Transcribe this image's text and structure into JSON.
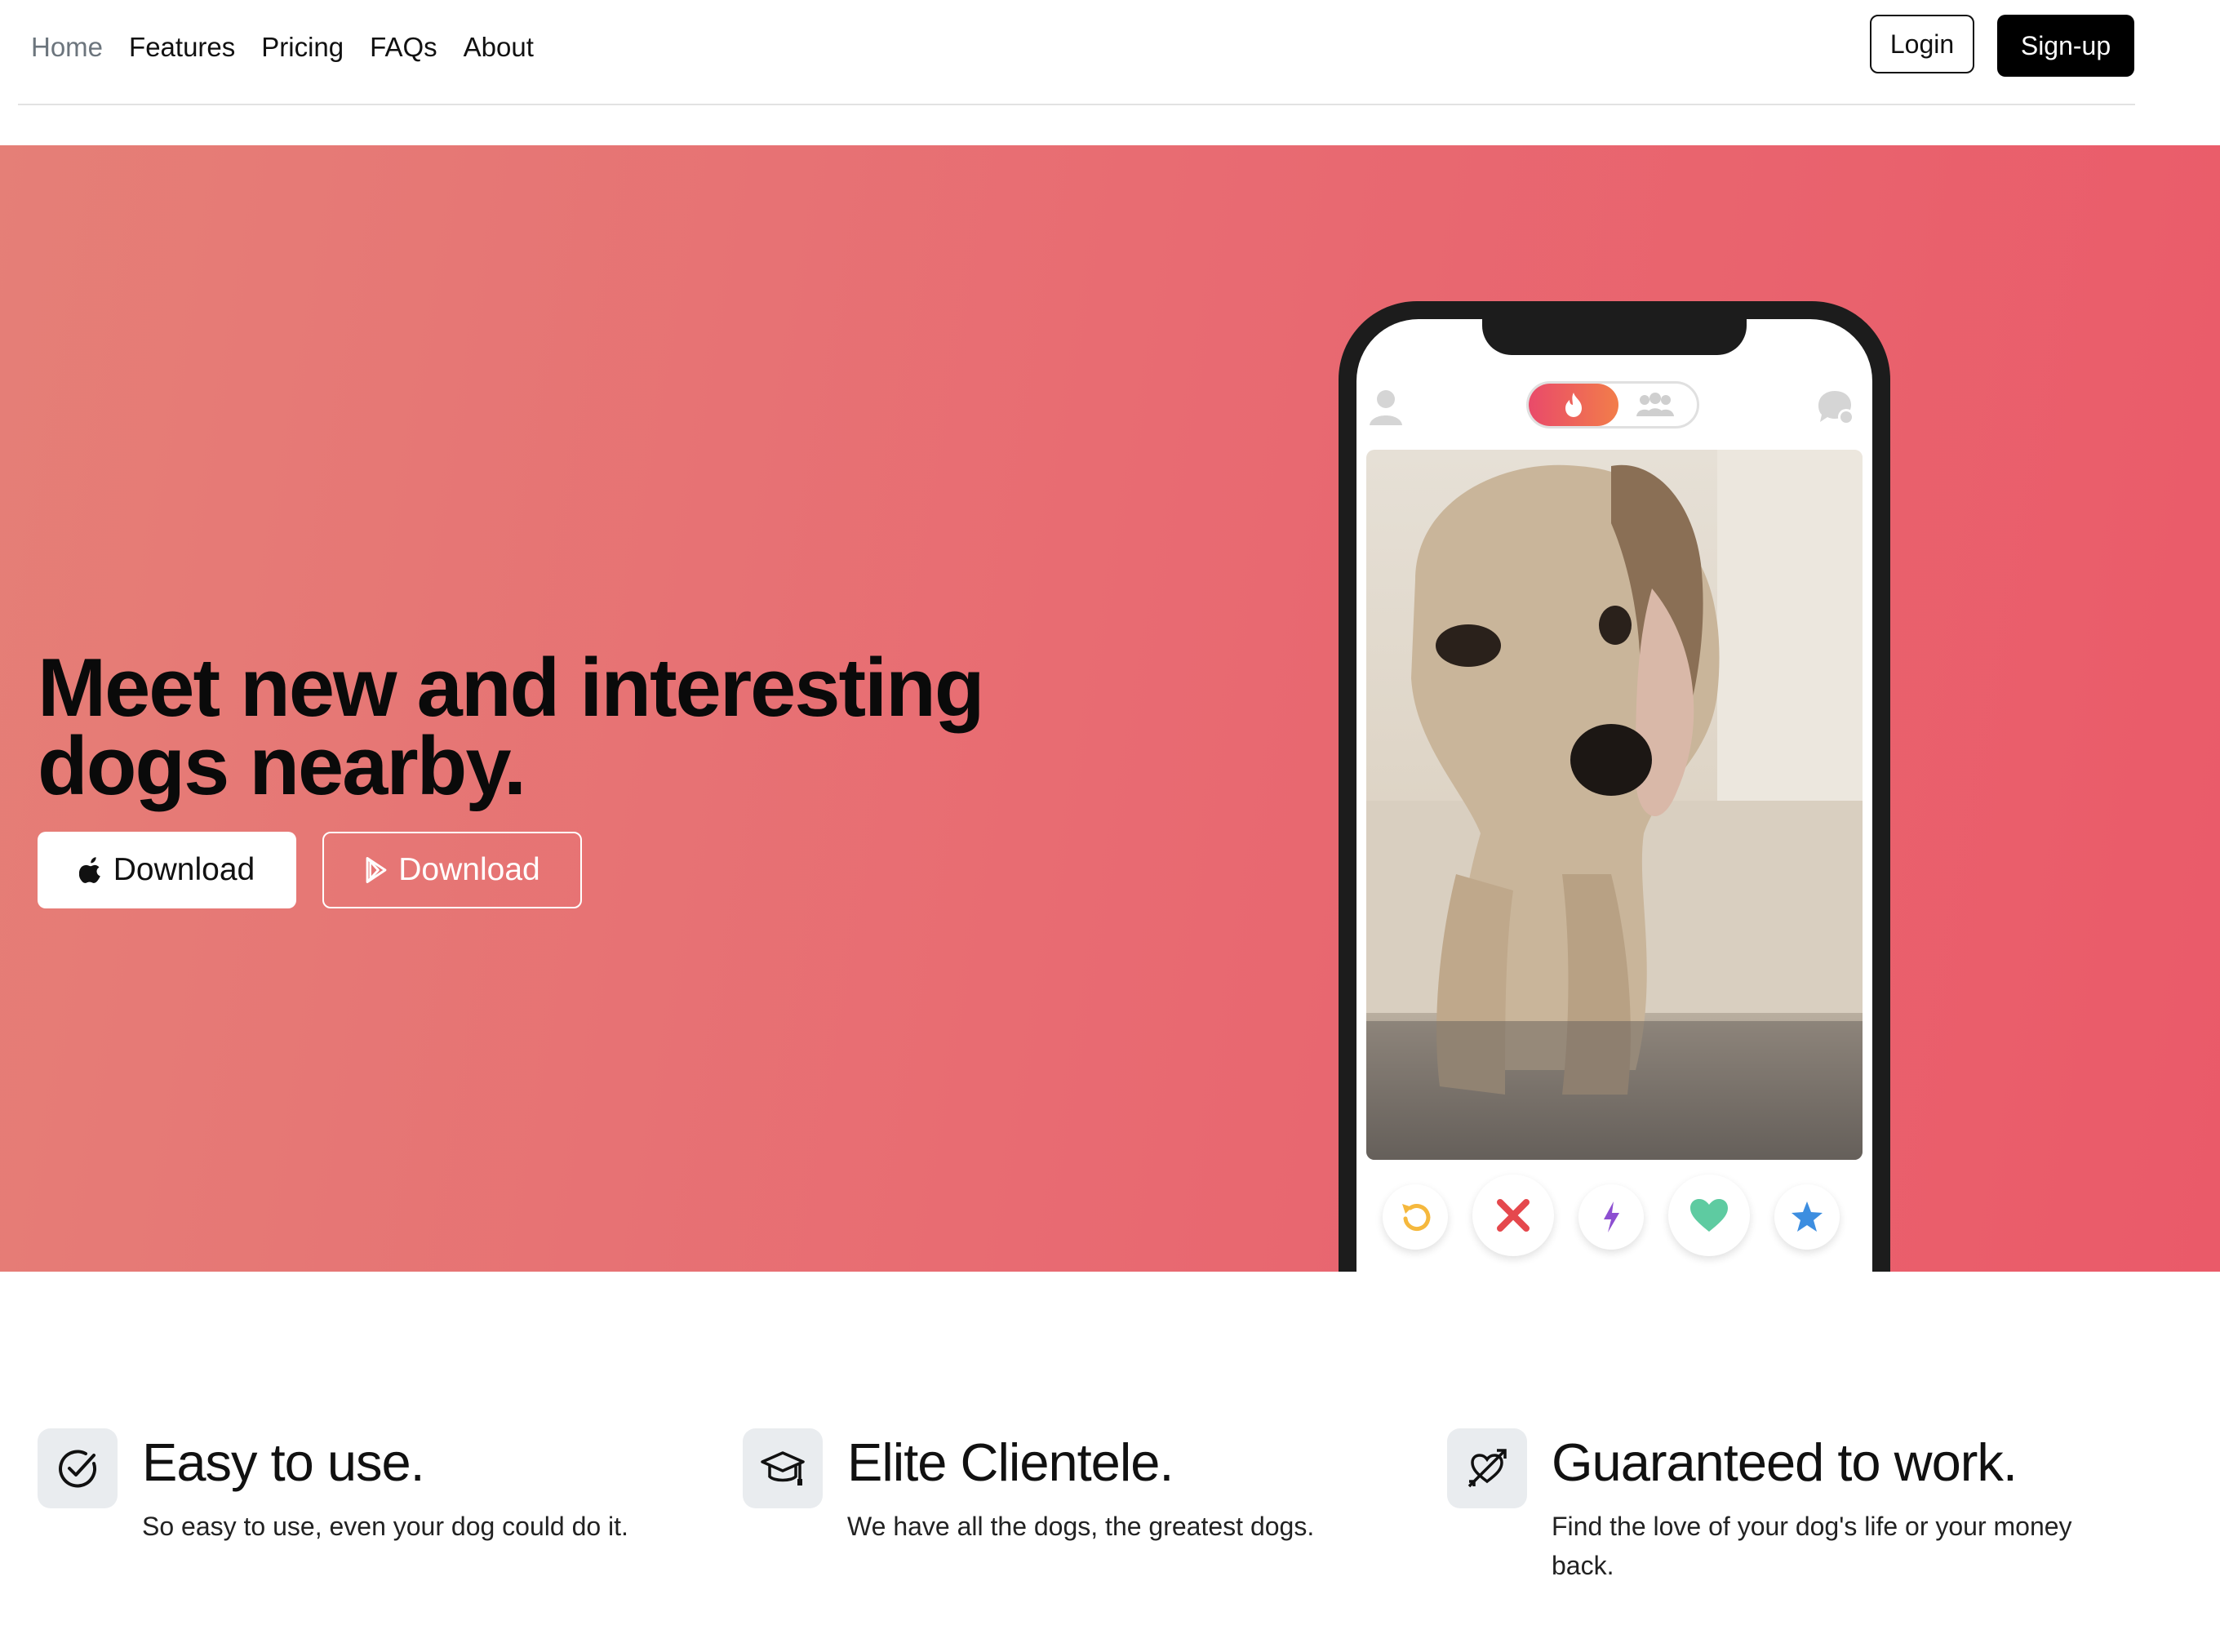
{
  "nav": {
    "links": [
      "Home",
      "Features",
      "Pricing",
      "FAQs",
      "About"
    ],
    "login_label": "Login",
    "signup_label": "Sign-up"
  },
  "hero": {
    "title": "Meet new and interesting dogs nearby.",
    "apple_download_label": "Download",
    "play_download_label": "Download"
  },
  "features": [
    {
      "icon": "check-circle-icon",
      "title": "Easy to use.",
      "text": "So easy to use, even your dog could do it."
    },
    {
      "icon": "graduation-cap-icon",
      "title": "Elite Clientele.",
      "text": "We have all the dogs, the greatest dogs."
    },
    {
      "icon": "heart-arrow-icon",
      "title": "Guaranteed to work.",
      "text": "Find the love of your dog's life or your money back."
    }
  ],
  "colors": {
    "hero_gradient_start": "#e57f77",
    "hero_gradient_end": "#ea5a69",
    "toggle_gradient_start": "#e94a6a",
    "toggle_gradient_end": "#f27d4a",
    "rewind": "#f5b83d",
    "nope": "#e5484d",
    "boost": "#8d4fd1",
    "like": "#5ecba1",
    "super_like": "#3d8ee0"
  }
}
